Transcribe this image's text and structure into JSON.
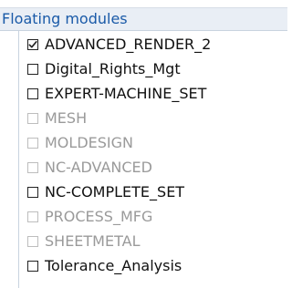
{
  "panel": {
    "title": "Floating modules"
  },
  "modules": [
    {
      "label": "ADVANCED_RENDER_2",
      "checked": true,
      "enabled": true
    },
    {
      "label": "Digital_Rights_Mgt",
      "checked": false,
      "enabled": true
    },
    {
      "label": "EXPERT-MACHINE_SET",
      "checked": false,
      "enabled": true
    },
    {
      "label": "MESH",
      "checked": false,
      "enabled": false
    },
    {
      "label": "MOLDESIGN",
      "checked": false,
      "enabled": false
    },
    {
      "label": "NC-ADVANCED",
      "checked": false,
      "enabled": false
    },
    {
      "label": "NC-COMPLETE_SET",
      "checked": false,
      "enabled": true
    },
    {
      "label": "PROCESS_MFG",
      "checked": false,
      "enabled": false
    },
    {
      "label": "SHEETMETAL",
      "checked": false,
      "enabled": false
    },
    {
      "label": "Tolerance_Analysis",
      "checked": false,
      "enabled": true
    }
  ],
  "colors": {
    "header_text": "#1a5aa8",
    "header_bg": "#e9eef5",
    "enabled_text": "#111111",
    "disabled_text": "#9a9a9a"
  }
}
